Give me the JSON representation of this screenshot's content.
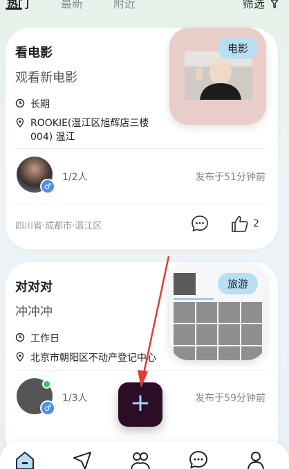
{
  "top_tabs": [
    "热门",
    "最新",
    "附近"
  ],
  "filter_label": "筛选",
  "cards": [
    {
      "title": "看电影",
      "subtitle": "观看新电影",
      "duration": "长期",
      "address": "ROOKIE(温江区旭辉店三楼004) 温江",
      "participants": "1/2人",
      "posted": "发布于51分钟前",
      "location": "四川省·成都市·温江区",
      "likes": "2",
      "tag": "电影"
    },
    {
      "title": "对对对",
      "subtitle": "冲冲冲",
      "duration": "工作日",
      "address": "北京市朝阳区不动产登记中心",
      "participants": "1/3人",
      "posted": "发布于59分钟前",
      "tag": "旅游"
    }
  ],
  "fab_label": "+",
  "bottom_nav": [
    "home-icon",
    "explore-icon",
    "friends-icon",
    "messages-icon",
    "profile-icon"
  ],
  "colors": {
    "accent": "#2b0d25",
    "tag_bg": "#b8dff1",
    "arrow": "#e53935"
  }
}
